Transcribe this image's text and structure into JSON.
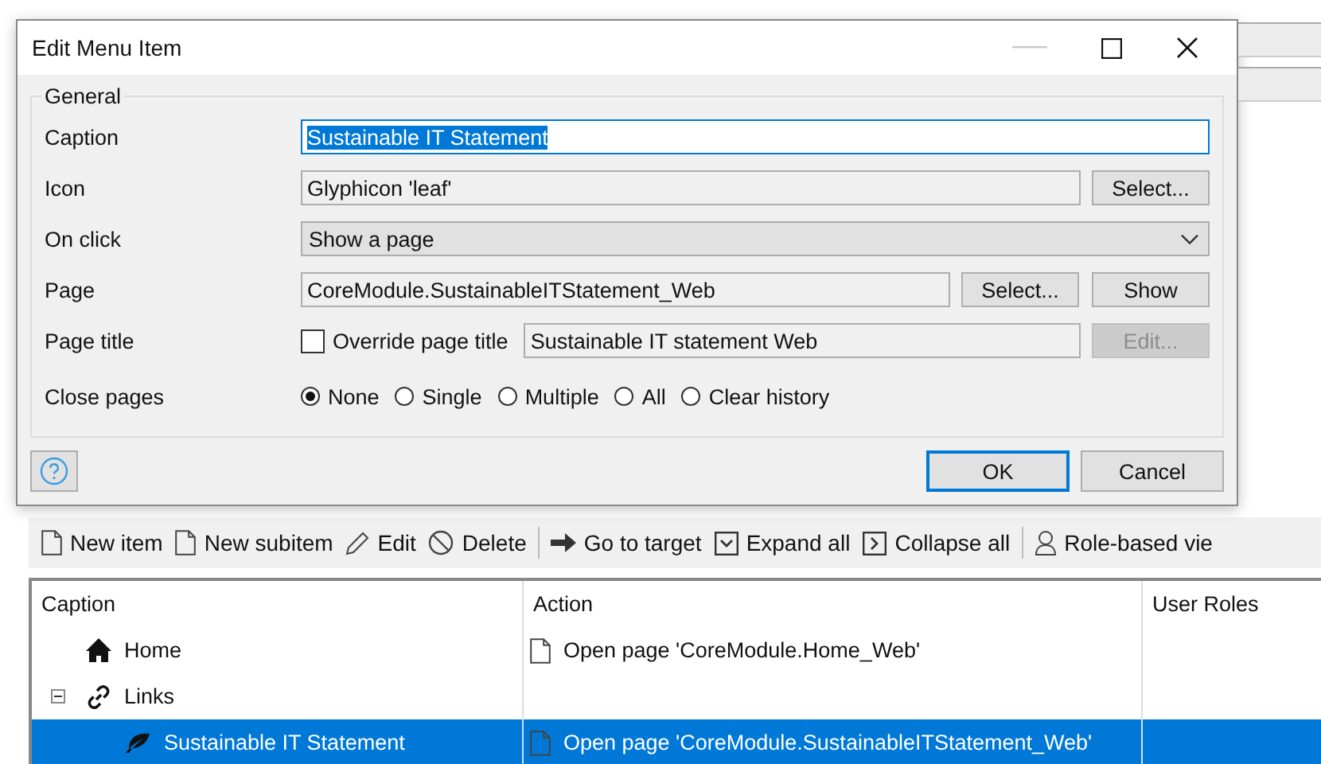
{
  "dialog": {
    "title": "Edit Menu Item",
    "group_title": "General",
    "caption": {
      "label": "Caption",
      "value": "Sustainable IT Statement"
    },
    "icon": {
      "label": "Icon",
      "value": "Glyphicon 'leaf'",
      "button": "Select..."
    },
    "on_click": {
      "label": "On click",
      "value": "Show a page"
    },
    "page": {
      "label": "Page",
      "value": "CoreModule.SustainableITStatement_Web",
      "buttons": [
        "Select...",
        "Show"
      ]
    },
    "page_title": {
      "label": "Page title",
      "checkbox_label": "Override page title",
      "checked": false,
      "value": "Sustainable IT statement Web",
      "button": {
        "label": "Edit...",
        "disabled": true
      }
    },
    "close_pages": {
      "label": "Close pages",
      "options": [
        {
          "label": "None",
          "selected": true
        },
        {
          "label": "Single",
          "selected": false
        },
        {
          "label": "Multiple",
          "selected": false
        },
        {
          "label": "All",
          "selected": false
        },
        {
          "label": "Clear history",
          "selected": false
        }
      ]
    },
    "ok": "OK",
    "cancel": "Cancel"
  },
  "toolbar": [
    {
      "kind": "doc",
      "label": "New item"
    },
    {
      "kind": "doc",
      "label": "New subitem"
    },
    {
      "kind": "pencil",
      "label": "Edit"
    },
    {
      "kind": "slash",
      "label": "Delete"
    },
    {
      "kind": "sep"
    },
    {
      "kind": "arrow",
      "label": "Go to target"
    },
    {
      "kind": "expand",
      "label": "Expand all"
    },
    {
      "kind": "collapse",
      "label": "Collapse all"
    },
    {
      "kind": "sep"
    },
    {
      "kind": "person",
      "label": "Role-based vie"
    }
  ],
  "grid": {
    "columns": [
      "Caption",
      "Action",
      "User Roles"
    ],
    "rows": [
      {
        "kind": "home",
        "caption": "Home",
        "action": "Open page 'CoreModule.Home_Web'",
        "selected": false
      },
      {
        "kind": "link",
        "caption": "Links",
        "expanded": true,
        "selected": false,
        "children": [
          {
            "kind": "leaf",
            "caption": "Sustainable IT Statement",
            "action": "Open page 'CoreModule.SustainableITStatement_Web'",
            "selected": true
          }
        ]
      }
    ]
  }
}
